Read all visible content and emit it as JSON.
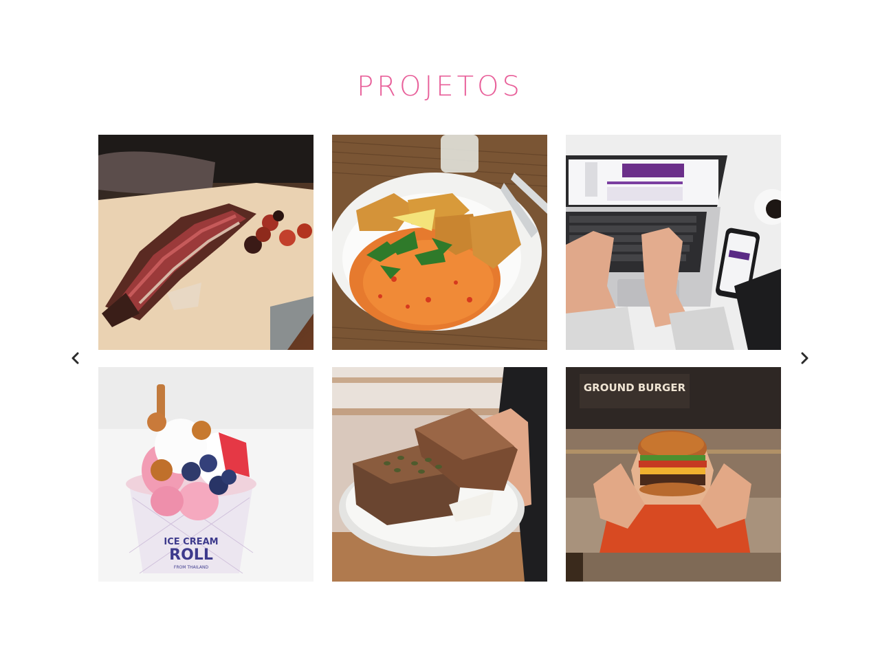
{
  "section": {
    "title": "PROJETOS",
    "title_color": "#e8609a"
  },
  "carousel": {
    "prev_icon": "chevron-left-icon",
    "next_icon": "chevron-right-icon",
    "projects": [
      {
        "name": "sliced-steak-photo"
      },
      {
        "name": "fried-fish-rice-photo"
      },
      {
        "name": "laptop-typing-photo"
      },
      {
        "name": "ice-cream-roll-photo",
        "cup_text_1": "ICE CREAM",
        "cup_text_2": "ROLL",
        "cup_text_3": "FROM THAILAND"
      },
      {
        "name": "bread-plate-photo"
      },
      {
        "name": "burger-photo",
        "sign_text": "GROUND BURGER"
      }
    ]
  }
}
